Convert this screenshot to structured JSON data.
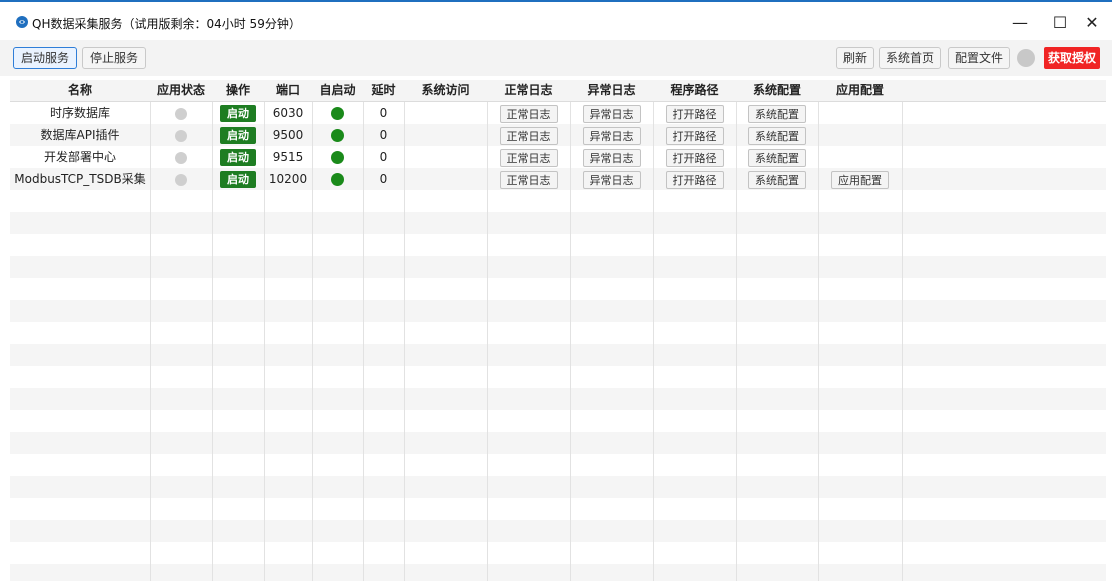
{
  "window": {
    "title": "QH数据采集服务（试用版剩余：04小时 59分钟）",
    "min_glyph": "—",
    "max_glyph": "☐",
    "close_glyph": "✕"
  },
  "toolbar": {
    "start_service": "启动服务",
    "stop_service": "停止服务",
    "refresh": "刷新",
    "system_home": "系统首页",
    "config_file": "配置文件",
    "get_license": "获取授权"
  },
  "colors": {
    "accent": "#2f7ed8",
    "license_red": "#f02424",
    "start_green": "#1e7d22",
    "autostart_green": "#1a8a1a",
    "status_gray": "#cfcfcf"
  },
  "table": {
    "headers": {
      "name": "名称",
      "app_status": "应用状态",
      "action": "操作",
      "port": "端口",
      "autostart": "自启动",
      "delay": "延时",
      "sys_access": "系统访问",
      "normal_log": "正常日志",
      "error_log": "异常日志",
      "program_path": "程序路径",
      "sys_config": "系统配置",
      "app_config": "应用配置"
    },
    "rows": [
      {
        "name": "时序数据库",
        "action": "启动",
        "port": "6030",
        "delay": "0",
        "normal_log": "正常日志",
        "error_log": "异常日志",
        "program_path": "打开路径",
        "sys_config": "系统配置"
      },
      {
        "name": "数据库API插件",
        "action": "启动",
        "port": "9500",
        "delay": "0",
        "normal_log": "正常日志",
        "error_log": "异常日志",
        "program_path": "打开路径",
        "sys_config": "系统配置"
      },
      {
        "name": "开发部署中心",
        "action": "启动",
        "port": "9515",
        "delay": "0",
        "normal_log": "正常日志",
        "error_log": "异常日志",
        "program_path": "打开路径",
        "sys_config": "系统配置"
      },
      {
        "name": "ModbusTCP_TSDB采集",
        "action": "启动",
        "port": "10200",
        "delay": "0",
        "normal_log": "正常日志",
        "error_log": "异常日志",
        "program_path": "打开路径",
        "sys_config": "系统配置",
        "app_config": "应用配置"
      }
    ]
  }
}
